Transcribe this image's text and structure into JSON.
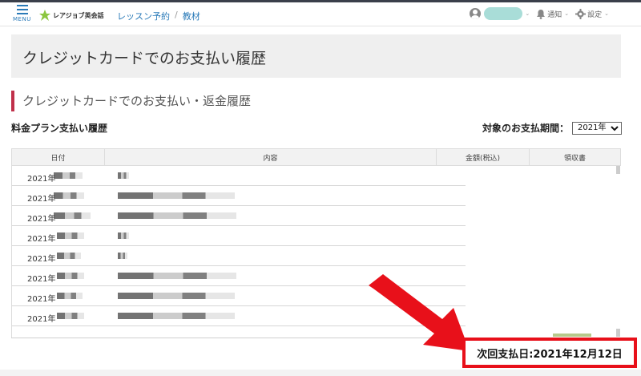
{
  "header": {
    "menu_label": "MENU",
    "logo_text": "レアジョブ英会話",
    "nav": [
      {
        "label": "レッスン予約"
      },
      {
        "label": "教材"
      }
    ],
    "nav_separator": "/",
    "notifications_label": "通知",
    "settings_label": "設定",
    "caret": "⌄"
  },
  "page": {
    "title": "クレジットカードでのお支払い履歴",
    "section_title": "クレジットカードでのお支払い・返金履歴",
    "sub_title": "料金プラン支払い履歴",
    "period_label": "対象のお支払期間：",
    "period_selected": "2021年",
    "period_options": [
      "2021年"
    ]
  },
  "table": {
    "headers": {
      "date": "日付",
      "content": "内容",
      "amount": "金額(税込)",
      "receipt": "領収書"
    },
    "rows": [
      {
        "date": "2021年"
      },
      {
        "date": "2021年"
      },
      {
        "date": "2021年"
      },
      {
        "date": "2021年"
      },
      {
        "date": "2021年"
      },
      {
        "date": "2021年"
      },
      {
        "date": "2021年"
      },
      {
        "date": "2021年"
      }
    ]
  },
  "next_payment": {
    "text": "次回支払日:2021年12月12日"
  },
  "colors": {
    "accent_blue": "#2a7ab8",
    "section_bar": "#c0304a",
    "highlight_red": "#e8101a"
  }
}
